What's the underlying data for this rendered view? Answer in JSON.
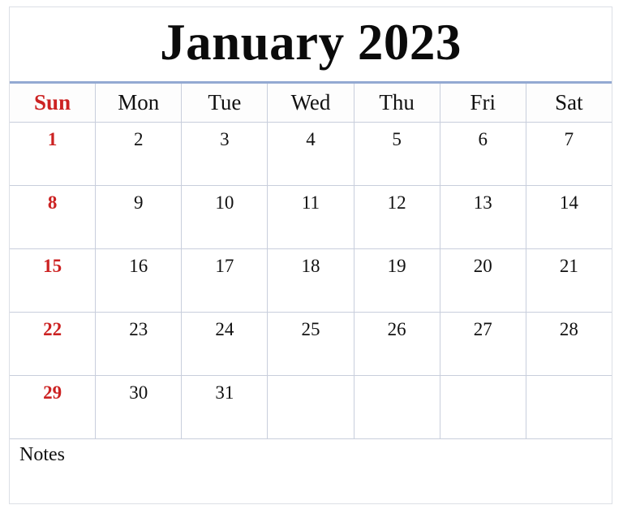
{
  "calendar": {
    "title": "January 2023",
    "month": "January",
    "year": "2023",
    "accent_red": "#cc2222",
    "rule_blue": "#93a9d2",
    "gridline": "#c8cedc",
    "weekday_headers": [
      {
        "label": "Sun",
        "highlight": true
      },
      {
        "label": "Mon",
        "highlight": false
      },
      {
        "label": "Tue",
        "highlight": false
      },
      {
        "label": "Wed",
        "highlight": false
      },
      {
        "label": "Thu",
        "highlight": false
      },
      {
        "label": "Fri",
        "highlight": false
      },
      {
        "label": "Sat",
        "highlight": false
      }
    ],
    "weeks": [
      [
        "1",
        "2",
        "3",
        "4",
        "5",
        "6",
        "7"
      ],
      [
        "8",
        "9",
        "10",
        "11",
        "12",
        "13",
        "14"
      ],
      [
        "15",
        "16",
        "17",
        "18",
        "19",
        "20",
        "21"
      ],
      [
        "22",
        "23",
        "24",
        "25",
        "26",
        "27",
        "28"
      ],
      [
        "29",
        "30",
        "31",
        "",
        "",
        "",
        ""
      ]
    ],
    "notes": {
      "label": "Notes",
      "content": ""
    }
  }
}
